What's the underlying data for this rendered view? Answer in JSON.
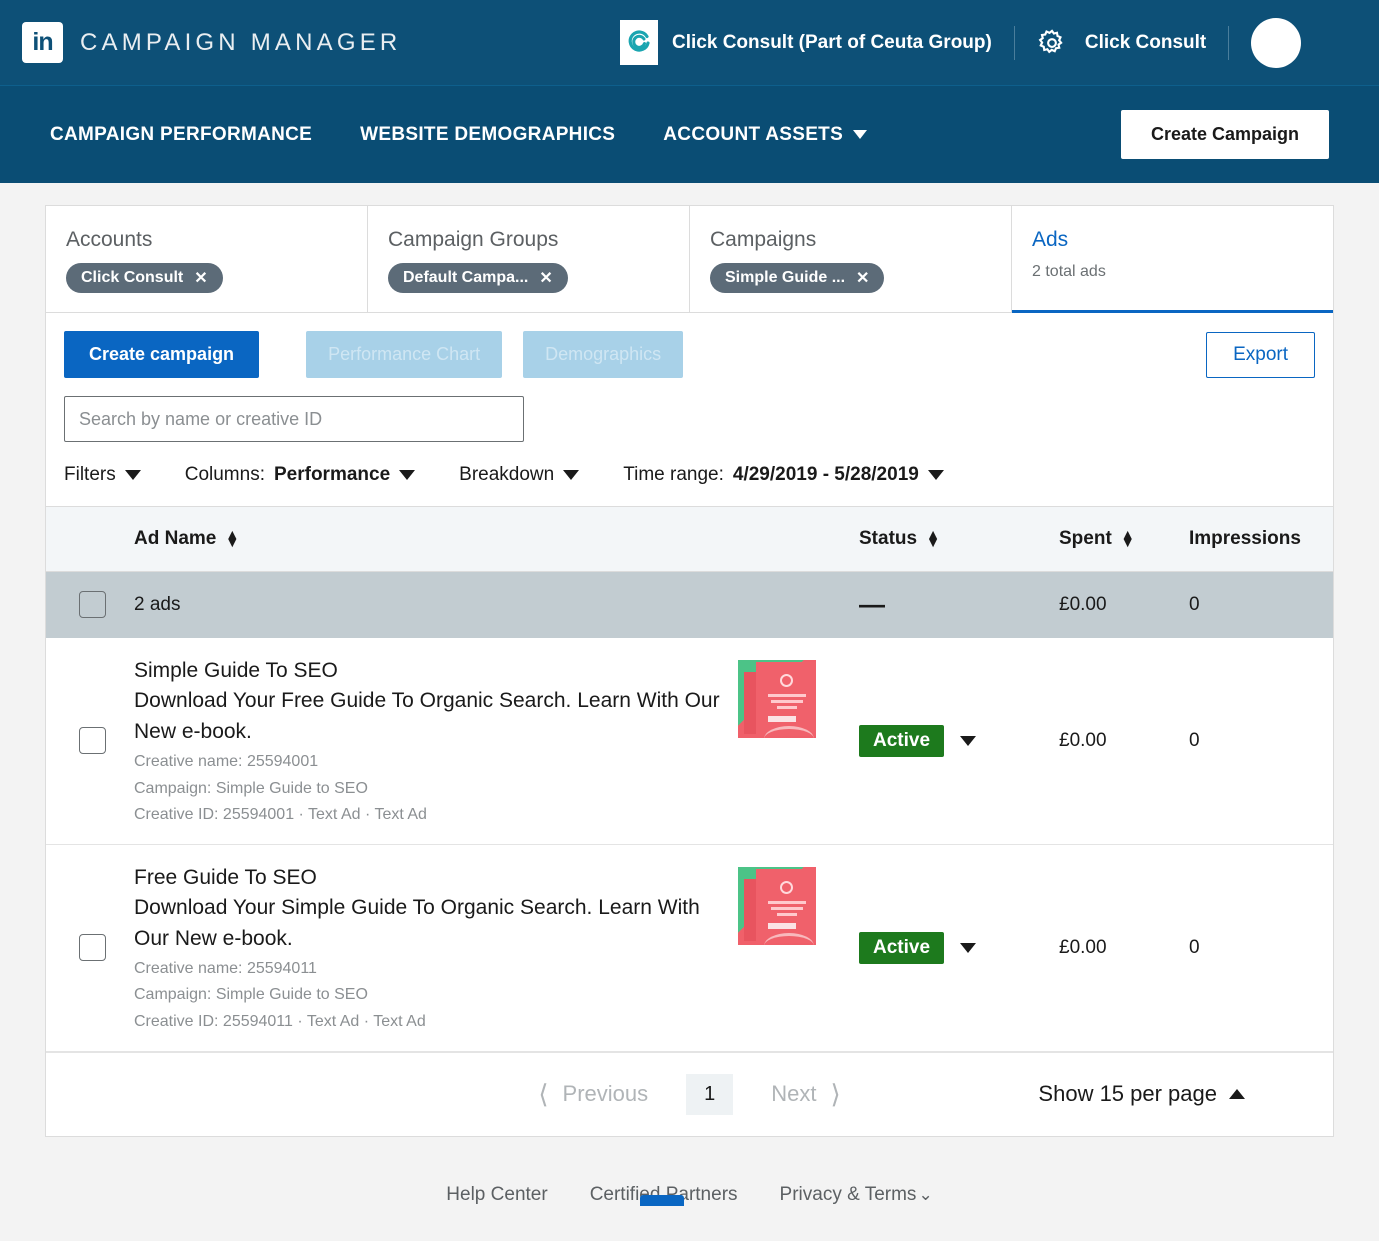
{
  "topbar": {
    "brand_title": "CAMPAIGN MANAGER",
    "linkedin_logo": "linkedin-logo-icon",
    "account_logo": "click-consult-logo-icon",
    "account_name": "Click Consult (Part of Ceuta Group)",
    "gear_icon": "gear-icon",
    "account_user": "Click Consult",
    "avatar": "avatar-icon"
  },
  "nav": {
    "items": [
      {
        "label": "CAMPAIGN PERFORMANCE",
        "has_caret": false
      },
      {
        "label": "WEBSITE DEMOGRAPHICS",
        "has_caret": false
      },
      {
        "label": "ACCOUNT ASSETS",
        "has_caret": true
      }
    ],
    "create_campaign": "Create Campaign"
  },
  "crumbs": [
    {
      "title": "Accounts",
      "pill": "Click Consult",
      "close": "✕",
      "active": false
    },
    {
      "title": "Campaign Groups",
      "pill": "Default Campa...",
      "close": "✕",
      "active": false
    },
    {
      "title": "Campaigns",
      "pill": "Simple Guide ...",
      "close": "✕",
      "active": false
    },
    {
      "title": "Ads",
      "sub": "2 total ads",
      "active": true
    }
  ],
  "toolbar": {
    "create_campaign": "Create campaign",
    "performance_chart": "Performance Chart",
    "demographics": "Demographics",
    "export": "Export"
  },
  "search": {
    "placeholder": "Search by name or creative ID",
    "value": ""
  },
  "filters": {
    "filters_label": "Filters",
    "columns_label": "Columns:",
    "columns_value": "Performance",
    "breakdown_label": "Breakdown",
    "timerange_label": "Time range:",
    "timerange_value": "4/29/2019 - 5/28/2019"
  },
  "table": {
    "headers": {
      "ad_name": "Ad Name",
      "status": "Status",
      "spent": "Spent",
      "impressions": "Impressions"
    },
    "summary": {
      "label": "2 ads",
      "status": "—",
      "spent": "£0.00",
      "impressions": "0"
    },
    "rows": [
      {
        "title": "Simple Guide To SEO",
        "description": "Download Your Free Guide To Organic Search. Learn With Our New e-book.",
        "creative_name": "Creative name: 25594001",
        "campaign": "Campaign: Simple Guide to SEO",
        "creative_id": "Creative ID: 25594001 · Text Ad · Text Ad",
        "status": "Active",
        "spent": "£0.00",
        "impressions": "0"
      },
      {
        "title": "Free Guide To SEO",
        "description": "Download Your Simple Guide To Organic Search. Learn With Our New e-book.",
        "creative_name": "Creative name: 25594011",
        "campaign": "Campaign: Simple Guide to SEO",
        "creative_id": "Creative ID: 25594011 · Text Ad · Text Ad",
        "status": "Active",
        "spent": "£0.00",
        "impressions": "0"
      }
    ]
  },
  "pagination": {
    "previous": "Previous",
    "page": "1",
    "next": "Next",
    "per_page": "Show 15 per page"
  },
  "footer": {
    "help_center": "Help Center",
    "certified_partners": "Certified Partners",
    "privacy_terms": "Privacy & Terms"
  },
  "colors": {
    "topbar_blue": "#0d5077",
    "nav_blue": "#0a4d74",
    "accent_blue": "#0a66c2",
    "pill_gray": "#5c6b78",
    "active_green": "#1d7a1d",
    "summary_row": "#c2ccd1"
  }
}
